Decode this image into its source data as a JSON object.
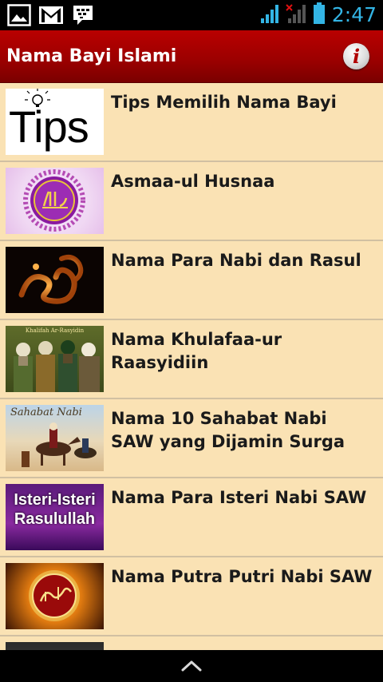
{
  "status_bar": {
    "time": "2:47",
    "icons": [
      "gallery-icon",
      "gmail-icon",
      "bbm-icon",
      "signal-icon",
      "no-signal-icon",
      "battery-icon"
    ]
  },
  "app_bar": {
    "title": "Nama Bayi Islami",
    "info_icon": "i"
  },
  "items": [
    {
      "title": "Tips Memilih Nama Bayi",
      "thumb_text": "Tips"
    },
    {
      "title": "Asmaa-ul Husnaa"
    },
    {
      "title": "Nama Para Nabi dan Rasul"
    },
    {
      "title": "Nama Khulafaa-ur Raasyidiin",
      "thumb_text": "Khalifah Ar-Rasyidin"
    },
    {
      "title": "Nama 10 Sahabat Nabi SAW yang Dijamin Surga",
      "thumb_text": "Sahabat Nabi"
    },
    {
      "title": "Nama Para Isteri Nabi SAW",
      "thumb_text": "Isteri-Isteri Rasulullah"
    },
    {
      "title": "Nama Putra Putri Nabi SAW"
    }
  ],
  "colors": {
    "app_bar": "#a80000",
    "list_bg": "#fae2b4",
    "divider": "#d1c0a2",
    "status_accent": "#33b5e5"
  }
}
